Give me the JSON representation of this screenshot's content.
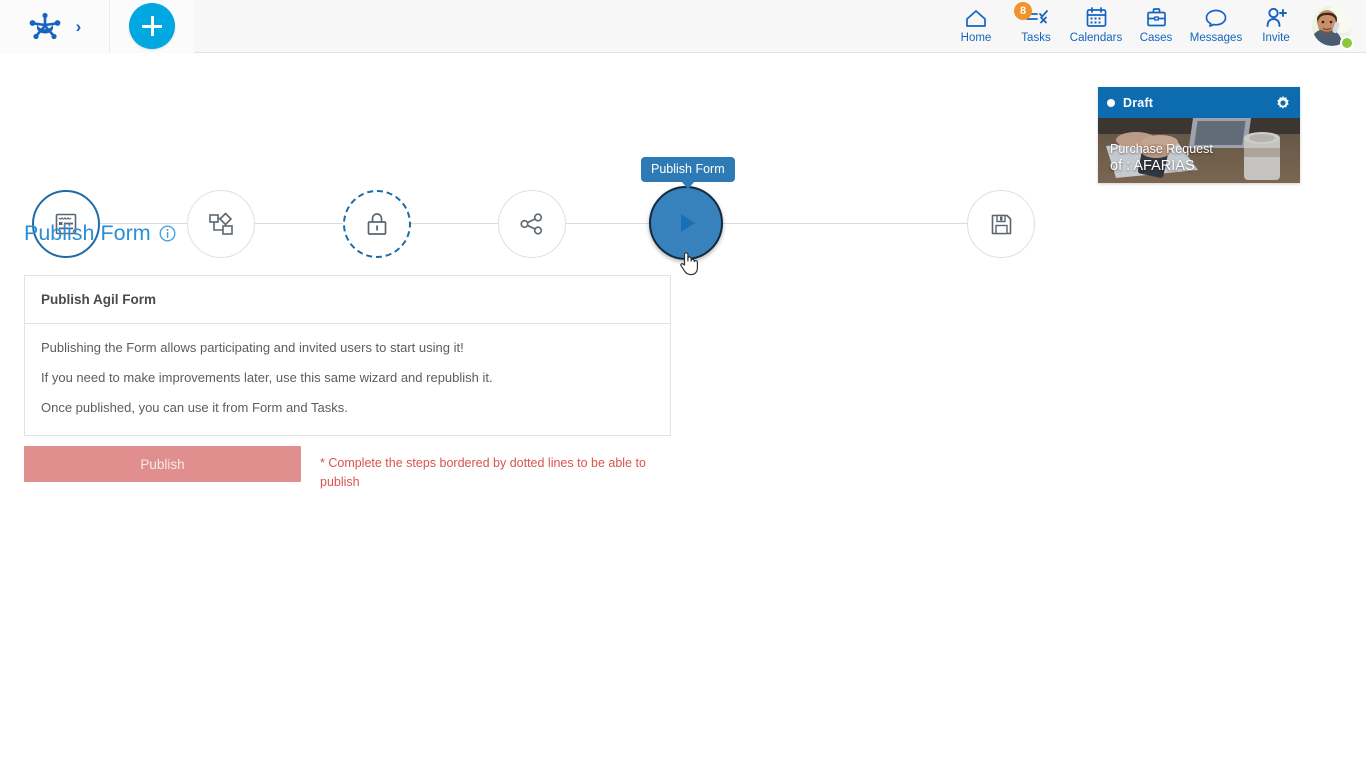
{
  "topbar": {
    "logo_name": "agil-logo",
    "expand_label": "›",
    "add_label": "+",
    "nav": [
      {
        "key": "home",
        "label": "Home",
        "icon": "home-icon",
        "badge": null
      },
      {
        "key": "tasks",
        "label": "Tasks",
        "icon": "tasks-icon",
        "badge": "8"
      },
      {
        "key": "calendars",
        "label": "Calendars",
        "icon": "calendar-icon",
        "badge": null
      },
      {
        "key": "cases",
        "label": "Cases",
        "icon": "briefcase-icon",
        "badge": null
      },
      {
        "key": "messages",
        "label": "Messages",
        "icon": "chat-icon",
        "badge": null
      },
      {
        "key": "invite",
        "label": "Invite",
        "icon": "invite-user-icon",
        "badge": null
      }
    ],
    "avatar_name": "user-avatar",
    "status": "online"
  },
  "stepper": {
    "tooltip": "Publish Form",
    "steps": [
      {
        "key": "form",
        "icon": "form-icon",
        "state": "completed"
      },
      {
        "key": "workflow",
        "icon": "workflow-icon",
        "state": "default"
      },
      {
        "key": "permissions",
        "icon": "lock-icon",
        "state": "pending-dotted"
      },
      {
        "key": "share",
        "icon": "share-icon",
        "state": "default"
      },
      {
        "key": "publish",
        "icon": "play-icon",
        "state": "current"
      },
      {
        "key": "save",
        "icon": "save-icon",
        "state": "default"
      }
    ]
  },
  "case_card": {
    "status": "Draft",
    "gear_icon": "gear-icon",
    "title_line1": "Purchase Request",
    "title_line2": "of : AFARIAS"
  },
  "main": {
    "page_title": "Publish Form",
    "info_icon": "info-icon",
    "panel_title": "Publish Agil Form",
    "paragraphs": [
      "Publishing the Form allows participating and invited users to start using it!",
      "If you need to make improvements later, use this same wizard and republish it.",
      "Once published, you can use it from Form and Tasks."
    ],
    "publish_button": "Publish",
    "warning": "* Complete the steps bordered by dotted lines to be able to publish"
  },
  "colors": {
    "accent_blue": "#2b8fd6",
    "nav_blue": "#1565c0",
    "add_cyan": "#00a7e1",
    "badge_orange": "#f0932b",
    "card_header_blue": "#0d6bb0",
    "tooltip_blue": "#2e7ab5",
    "step_filled": "#3782bd",
    "publish_red": "#e08e8e",
    "warning_red": "#d9534f",
    "status_green": "#8dc63f"
  }
}
